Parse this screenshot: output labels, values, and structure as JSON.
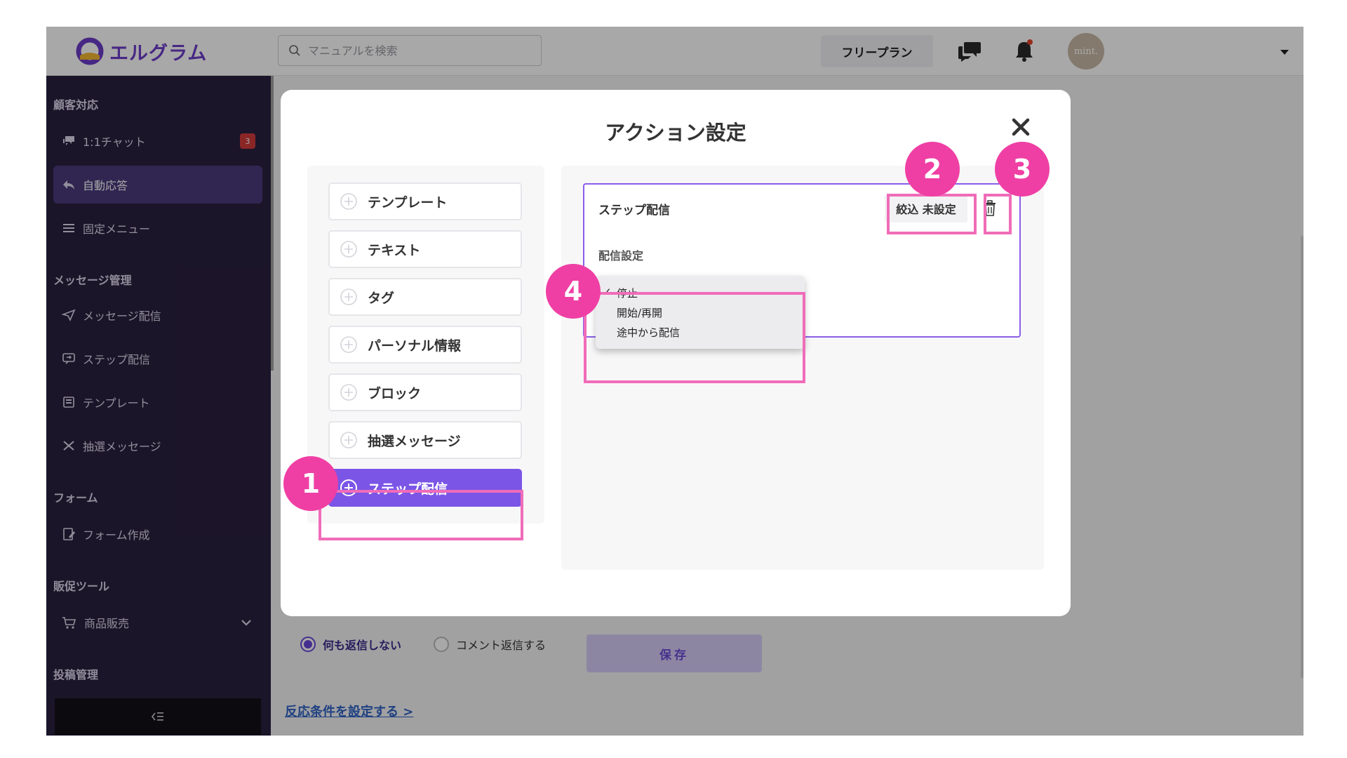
{
  "header": {
    "app_name": "エルグラム",
    "search_placeholder": "マニュアルを検索",
    "plan_label": "フリープラン",
    "avatar_text": "mint."
  },
  "sidebar": {
    "sections": {
      "customer": "顧客対応",
      "message": "メッセージ管理",
      "form": "フォーム",
      "promo": "販促ツール",
      "post": "投稿管理"
    },
    "items": {
      "chat": "1:1チャット",
      "chat_badge": "3",
      "auto_reply": "自動応答",
      "fixed_menu": "固定メニュー",
      "message_send": "メッセージ配信",
      "step_send": "ステップ配信",
      "template": "テンプレート",
      "lottery": "抽選メッセージ",
      "form_create": "フォーム作成",
      "product_sales": "商品販売"
    }
  },
  "background": {
    "radio_no_reply": "何も返信しない",
    "radio_comment_reply": "コメント返信する",
    "save_label": "保存",
    "condition_link": "反応条件を設定する >"
  },
  "modal": {
    "title": "アクション設定",
    "actions": [
      "テンプレート",
      "テキスト",
      "タグ",
      "パーソナル情報",
      "ブロック",
      "抽選メッセージ",
      "ステップ配信"
    ],
    "card": {
      "title": "ステップ配信",
      "filter_label": "絞込 未設定",
      "delivery_label": "配信設定",
      "options": [
        {
          "label": "停止",
          "checked": true
        },
        {
          "label": "開始/再開",
          "checked": false
        },
        {
          "label": "途中から配信",
          "checked": false
        }
      ],
      "check_mark": "✓"
    }
  },
  "annotations": [
    "1",
    "2",
    "3",
    "4"
  ],
  "colors": {
    "accent": "#7b55e6",
    "highlight": "#f06cb8",
    "marker": "#ef3fa4",
    "sidebar": "#2a2040"
  }
}
